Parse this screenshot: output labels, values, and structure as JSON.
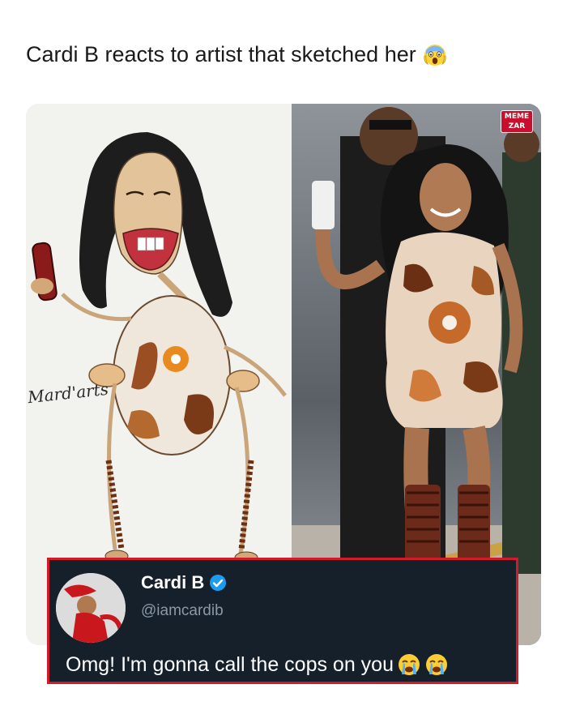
{
  "caption": {
    "text": "Cardi B reacts to artist that sketched her",
    "emoji": "screaming-face-emoji"
  },
  "photo": {
    "left_panel": "sketch-caricature",
    "right_panel": "photo-of-person",
    "signature": "Mard'arts",
    "watermark": {
      "line1": "MEME",
      "line2": "ZAR"
    }
  },
  "tweet": {
    "name": "Cardi B",
    "handle": "@iamcardib",
    "text": "Omg! I'm gonna call the cops on you",
    "verified": true,
    "emojis": [
      "loudly-crying-face-emoji",
      "loudly-crying-face-emoji"
    ]
  },
  "colors": {
    "tweet_bg": "#15202b",
    "tweet_border": "#d11a2a",
    "verified_blue": "#1d9bf0",
    "watermark_red": "#c8102e"
  }
}
